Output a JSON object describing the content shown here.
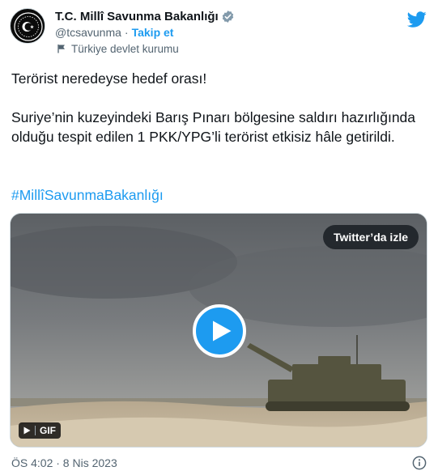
{
  "author": {
    "display_name": "T.C. Millî Savunma Bakanlığı",
    "handle": "@tcsavunma",
    "separator": "·",
    "follow_label": "Takip et",
    "account_label": "Türkiye devlet kurumu"
  },
  "tweet": {
    "line1": "Terörist neredeyse hedef orası!",
    "paragraph2": "Suriye’nin kuzeyindeki Barış Pınarı bölgesine saldırı hazırlığında olduğu tespit edilen 1 PKK/YPG’li  terörist etkisiz hâle getirildi.",
    "hashtag": "#MillîSavunmaBakanlığı"
  },
  "media": {
    "watch_label": "Twitter’da izle",
    "gif_label": "GIF"
  },
  "timestamp": "ÖS 4:02 · 8 Nis 2023",
  "colors": {
    "accent": "#1d9bf0",
    "text_primary": "#0f1419",
    "text_secondary": "#536471",
    "border": "#cfd9de"
  },
  "icons": {
    "avatar": "ministry-emblem-icon",
    "verified": "verified-badge-icon",
    "label": "flag-icon",
    "brand": "twitter-bird-icon",
    "play": "play-icon",
    "info": "info-icon"
  }
}
